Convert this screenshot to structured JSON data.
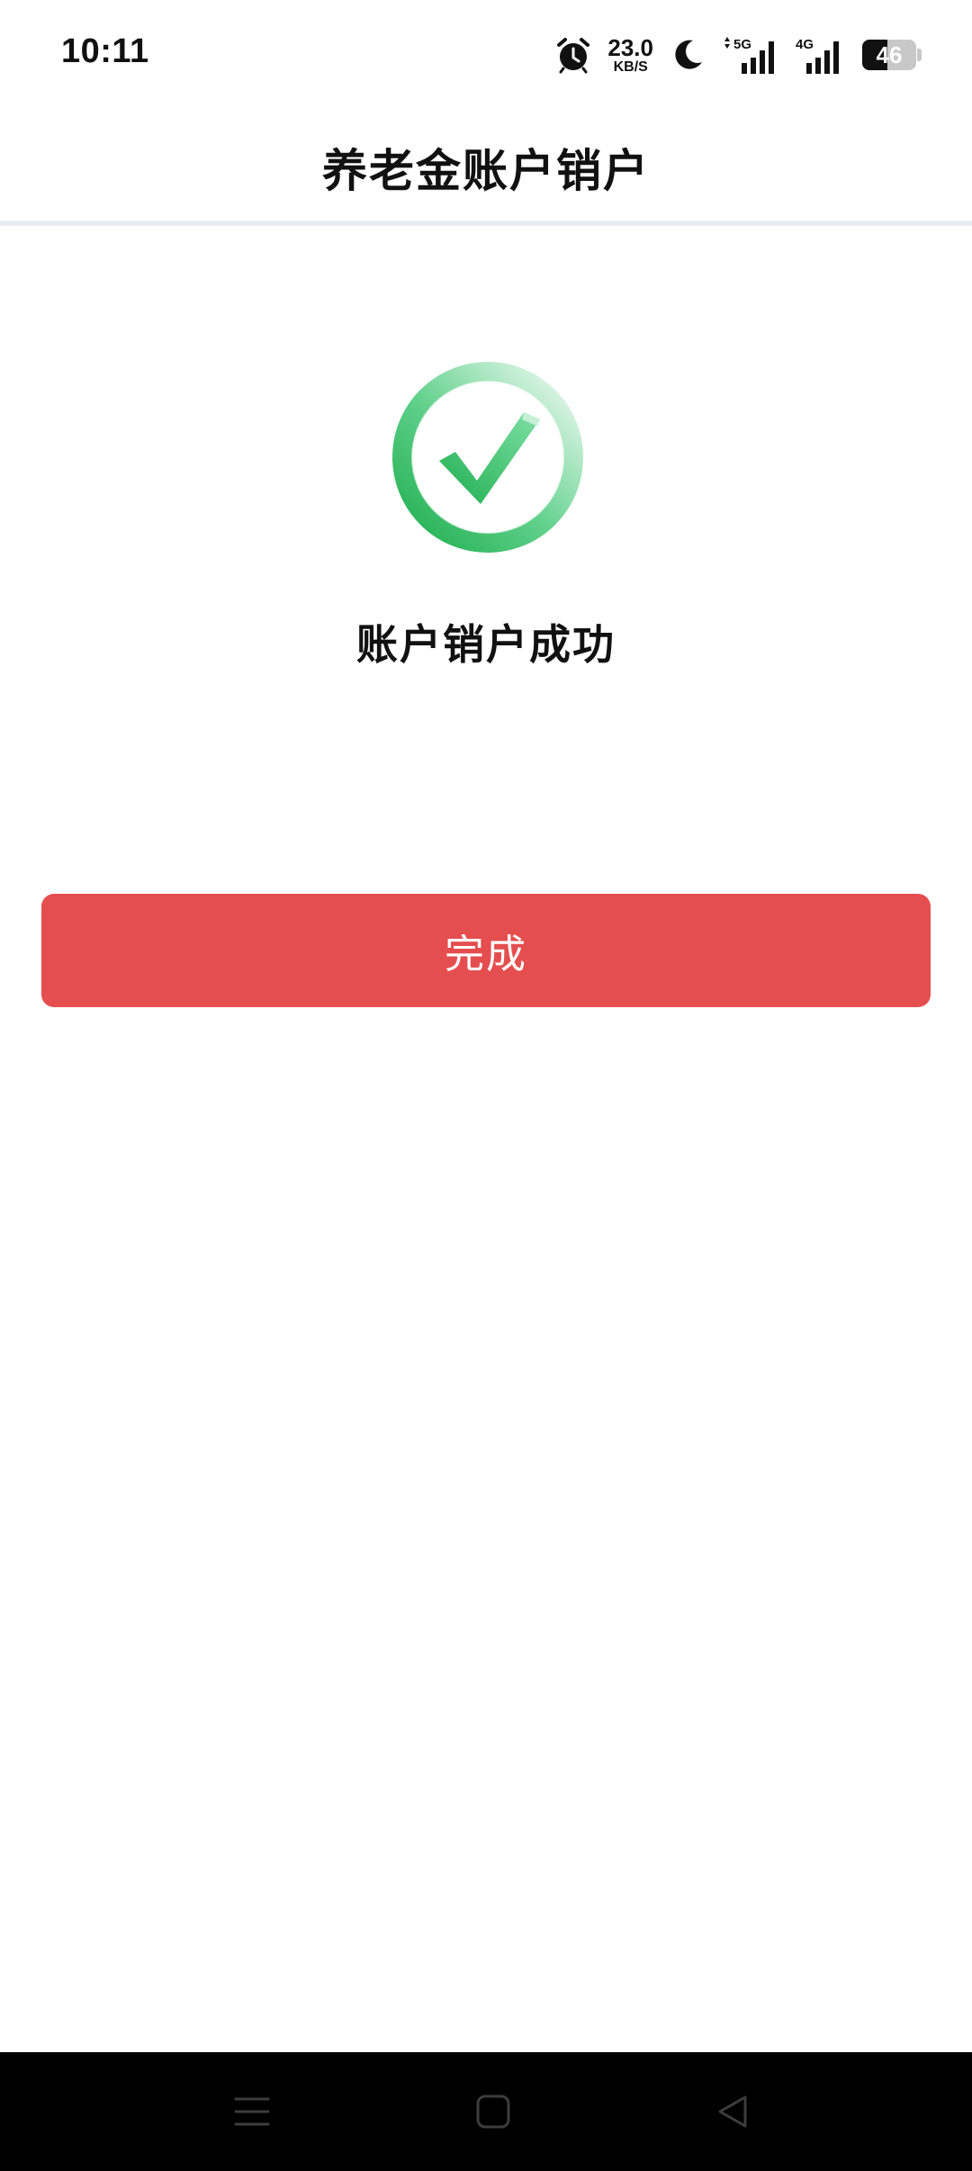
{
  "status_bar": {
    "time": "10:11",
    "speed_value": "23.0",
    "speed_unit": "KB/S",
    "sim1_type": "5G",
    "sim2_type": "4G",
    "battery_level": 46,
    "battery_text": "46",
    "icons": [
      "alarm-icon",
      "moon-icon",
      "signal-5g-icon",
      "signal-4g-icon",
      "battery-icon"
    ]
  },
  "header": {
    "title": "养老金账户销户"
  },
  "result": {
    "icon": "success-check-icon",
    "message": "账户销户成功"
  },
  "actions": {
    "done_label": "完成"
  },
  "nav_bar": {
    "icons": [
      "menu-icon",
      "home-icon",
      "back-icon"
    ]
  },
  "colors": {
    "accent": "#e54e4f",
    "success": "#2fbf62",
    "divider": "#e9eef4",
    "nav_bg": "#000000"
  }
}
